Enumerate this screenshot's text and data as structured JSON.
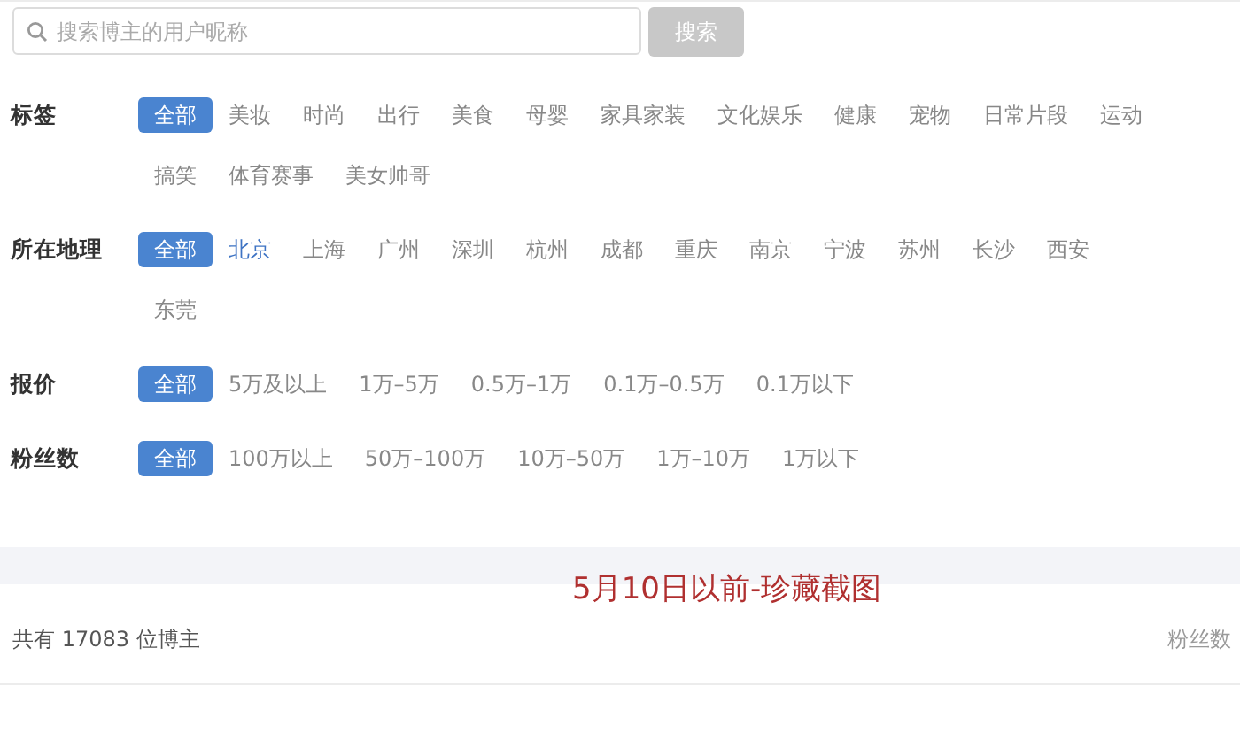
{
  "search": {
    "placeholder": "搜索博主的用户昵称",
    "button": {
      "label": "搜索",
      "disabled": true
    }
  },
  "filters": [
    {
      "label": "标签",
      "lines": [
        [
          {
            "text": "全部",
            "selected": true,
            "active": false
          },
          {
            "text": "美妆",
            "selected": false,
            "active": false
          },
          {
            "text": "时尚",
            "selected": false,
            "active": false
          },
          {
            "text": "出行",
            "selected": false,
            "active": false
          },
          {
            "text": "美食",
            "selected": false,
            "active": false
          },
          {
            "text": "母婴",
            "selected": false,
            "active": false
          },
          {
            "text": "家具家装",
            "selected": false,
            "active": false
          },
          {
            "text": "文化娱乐",
            "selected": false,
            "active": false
          },
          {
            "text": "健康",
            "selected": false,
            "active": false
          },
          {
            "text": "宠物",
            "selected": false,
            "active": false
          },
          {
            "text": "日常片段",
            "selected": false,
            "active": false
          },
          {
            "text": "运动",
            "selected": false,
            "active": false
          }
        ],
        [
          {
            "text": "搞笑",
            "selected": false,
            "active": false
          },
          {
            "text": "体育赛事",
            "selected": false,
            "active": false
          },
          {
            "text": "美女帅哥",
            "selected": false,
            "active": false
          }
        ]
      ]
    },
    {
      "label": "所在地理",
      "lines": [
        [
          {
            "text": "全部",
            "selected": true,
            "active": false
          },
          {
            "text": "北京",
            "selected": false,
            "active": true
          },
          {
            "text": "上海",
            "selected": false,
            "active": false
          },
          {
            "text": "广州",
            "selected": false,
            "active": false
          },
          {
            "text": "深圳",
            "selected": false,
            "active": false
          },
          {
            "text": "杭州",
            "selected": false,
            "active": false
          },
          {
            "text": "成都",
            "selected": false,
            "active": false
          },
          {
            "text": "重庆",
            "selected": false,
            "active": false
          },
          {
            "text": "南京",
            "selected": false,
            "active": false
          },
          {
            "text": "宁波",
            "selected": false,
            "active": false
          },
          {
            "text": "苏州",
            "selected": false,
            "active": false
          },
          {
            "text": "长沙",
            "selected": false,
            "active": false
          },
          {
            "text": "西安",
            "selected": false,
            "active": false
          }
        ],
        [
          {
            "text": "东莞",
            "selected": false,
            "active": false
          }
        ]
      ]
    },
    {
      "label": "报价",
      "lines": [
        [
          {
            "text": "全部",
            "selected": true,
            "active": false
          },
          {
            "text": "5万及以上",
            "selected": false,
            "active": false
          },
          {
            "text": "1万–5万",
            "selected": false,
            "active": false
          },
          {
            "text": "0.5万–1万",
            "selected": false,
            "active": false
          },
          {
            "text": "0.1万–0.5万",
            "selected": false,
            "active": false
          },
          {
            "text": "0.1万以下",
            "selected": false,
            "active": false
          }
        ]
      ]
    },
    {
      "label": "粉丝数",
      "lines": [
        [
          {
            "text": "全部",
            "selected": true,
            "active": false
          },
          {
            "text": "100万以上",
            "selected": false,
            "active": false
          },
          {
            "text": "50万–100万",
            "selected": false,
            "active": false
          },
          {
            "text": "10万–50万",
            "selected": false,
            "active": false
          },
          {
            "text": "1万–10万",
            "selected": false,
            "active": false
          },
          {
            "text": "1万以下",
            "selected": false,
            "active": false
          }
        ]
      ]
    }
  ],
  "annotation": "5月10日以前-珍藏截图",
  "summary": {
    "count_text": "共有 17083 位博主",
    "sort_label": "粉丝数"
  }
}
